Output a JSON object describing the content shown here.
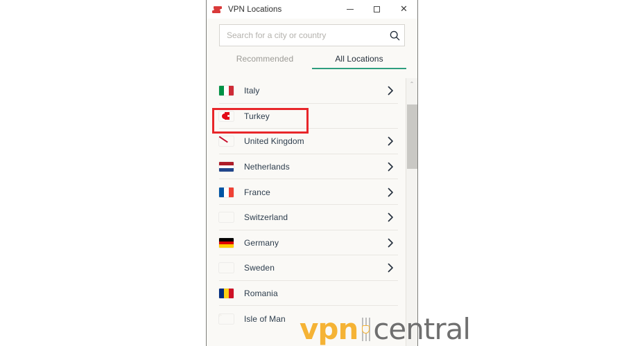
{
  "window": {
    "title": "VPN Locations",
    "logo_icon": "expressvpn-logo-icon",
    "controls": [
      {
        "name": "minimize",
        "glyph": "–"
      },
      {
        "name": "maximize",
        "glyph": "□"
      },
      {
        "name": "close",
        "glyph": "✕"
      }
    ]
  },
  "search": {
    "placeholder": "Search for a city or country",
    "value": "",
    "icon": "search-icon"
  },
  "tabs": [
    {
      "id": "recommended",
      "label": "Recommended",
      "active": false
    },
    {
      "id": "all-locations",
      "label": "All Locations",
      "active": true
    }
  ],
  "accent_color": "#2e9e7e",
  "highlight_color": "#e8262a",
  "locations": [
    {
      "name": "Italy",
      "flag": "it",
      "chevron": true
    },
    {
      "name": "Turkey",
      "flag": "tr",
      "chevron": false,
      "highlighted": true
    },
    {
      "name": "United Kingdom",
      "flag": "gb",
      "chevron": true
    },
    {
      "name": "Netherlands",
      "flag": "nl",
      "chevron": true
    },
    {
      "name": "France",
      "flag": "fr",
      "chevron": true
    },
    {
      "name": "Switzerland",
      "flag": "ch",
      "chevron": true
    },
    {
      "name": "Germany",
      "flag": "de",
      "chevron": true
    },
    {
      "name": "Sweden",
      "flag": "se",
      "chevron": true
    },
    {
      "name": "Romania",
      "flag": "ro",
      "chevron": false
    },
    {
      "name": "Isle of Man",
      "flag": "im",
      "chevron": false
    }
  ],
  "scrollbar": {
    "up_arrow": "⌃"
  },
  "watermark": {
    "part1": "vpn",
    "part2": "central",
    "color1": "#f5b335",
    "color2": "#6f6f6f"
  }
}
